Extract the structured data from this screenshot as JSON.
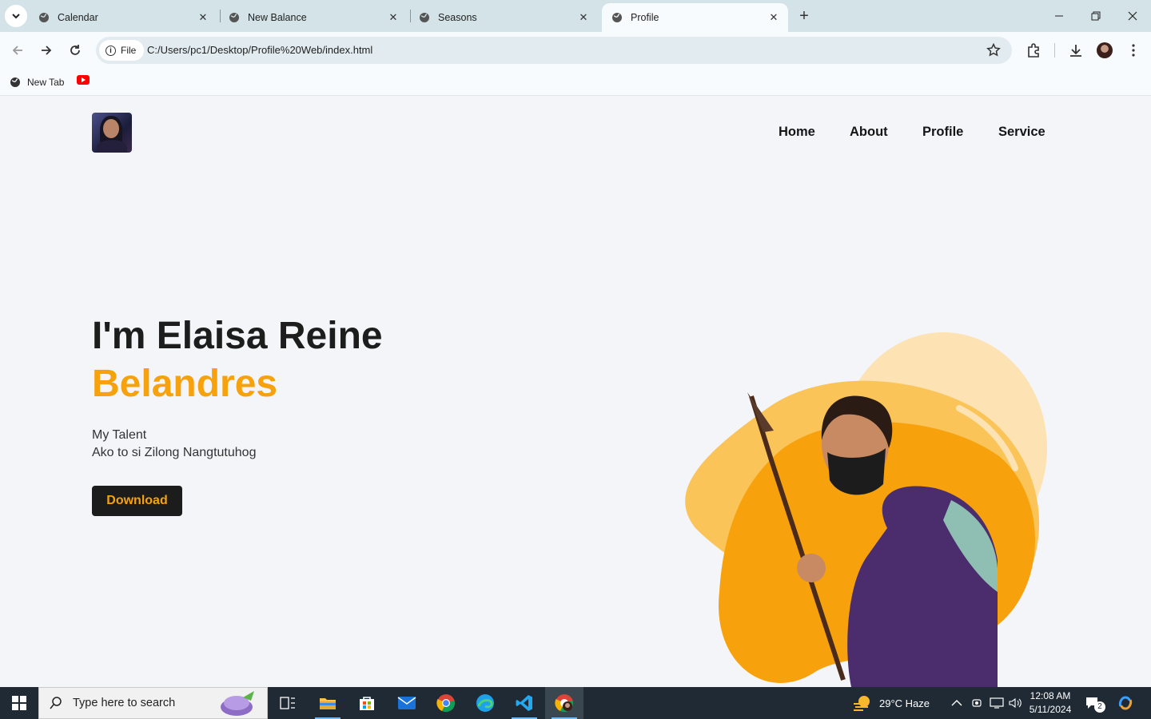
{
  "browser": {
    "tabs": [
      {
        "label": "Calendar",
        "active": false
      },
      {
        "label": "New Balance",
        "active": false
      },
      {
        "label": "Seasons",
        "active": false
      },
      {
        "label": "Profile",
        "active": true
      }
    ],
    "site_chip": "File",
    "url": "C:/Users/pc1/Desktop/Profile%20Web/index.html",
    "bookmarks": [
      {
        "label": "New Tab",
        "icon": "globe-icon"
      },
      {
        "label": "",
        "icon": "youtube-icon"
      }
    ]
  },
  "page": {
    "nav": [
      "Home",
      "About",
      "Profile",
      "Service"
    ],
    "hero": {
      "line1": "I'm Elaisa Reine",
      "line2": "Belandres",
      "talent_label": "My Talent",
      "talent_text": "Ako to si Zilong Nangtutuhog",
      "button": "Download"
    },
    "accent_color": "#f7a20d",
    "dark_color": "#1c1c1c"
  },
  "taskbar": {
    "search_placeholder": "Type here to search",
    "weather": "29°C  Haze",
    "time": "12:08 AM",
    "date": "5/11/2024",
    "notifications": "2"
  }
}
